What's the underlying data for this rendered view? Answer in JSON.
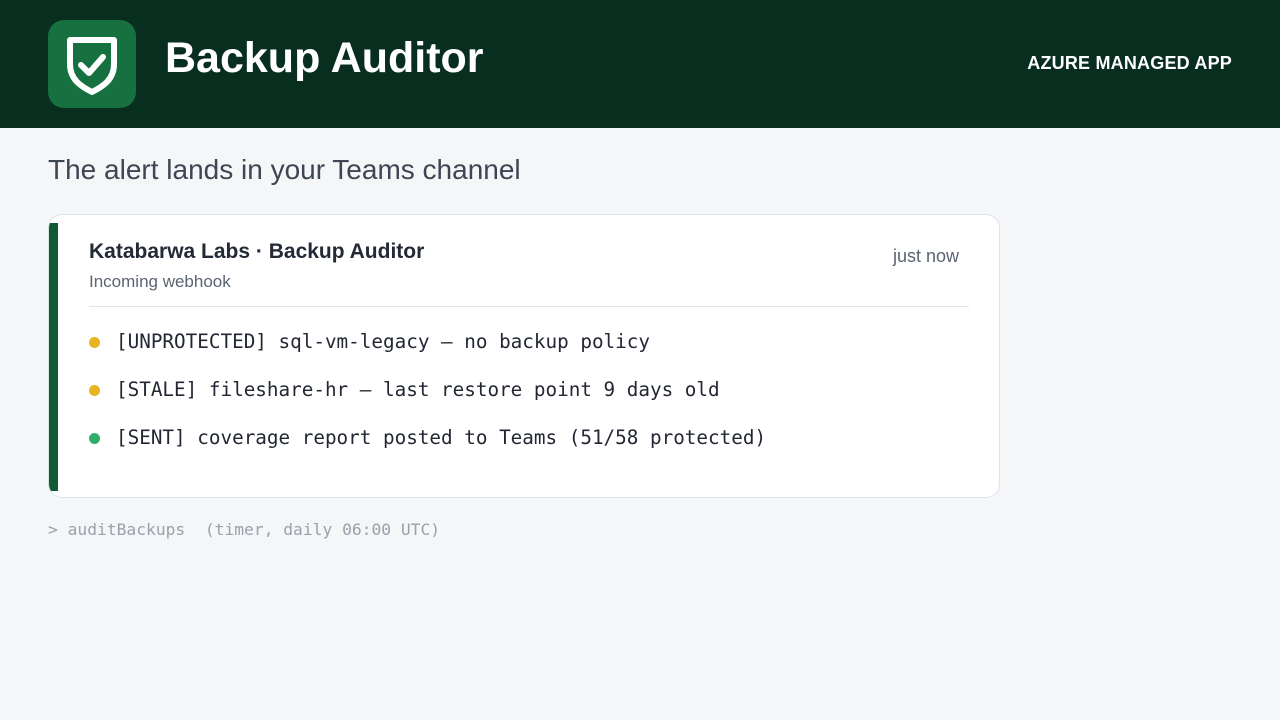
{
  "header": {
    "logo_icon": "shield-check-icon",
    "title": "Backup Auditor",
    "badge": "AZURE MANAGED APP",
    "colors": {
      "background": "#082e1f",
      "logo_background": "#16703f"
    }
  },
  "section": {
    "title": "The alert lands in your Teams channel"
  },
  "card": {
    "title": "Katabarwa Labs · Backup Auditor",
    "subtitle": "Incoming webhook",
    "time": "just now",
    "accent_color": "#0f5a34",
    "alerts": [
      {
        "text": "[UNPROTECTED] sql-vm-legacy — no backup policy",
        "status": "warning",
        "dot_color": "#e8b424"
      },
      {
        "text": "[STALE] fileshare-hr — last restore point 9 days old",
        "status": "warning",
        "dot_color": "#e8b424"
      },
      {
        "text": "[SENT] coverage report posted to Teams (51/58 protected)",
        "status": "success",
        "dot_color": "#2faf6a"
      }
    ]
  },
  "console": {
    "line": "> auditBackups  (timer, daily 06:00 UTC)"
  }
}
